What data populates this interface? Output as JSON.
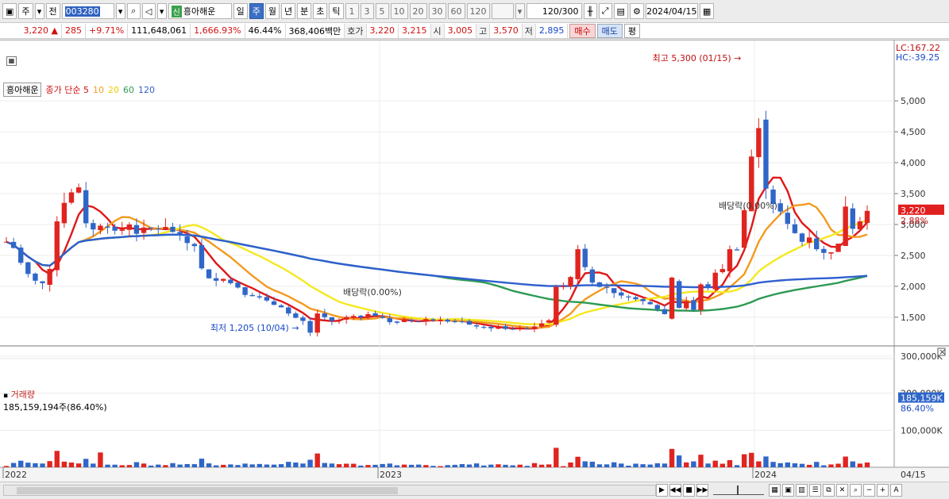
{
  "toolbar": {
    "market": "주",
    "prev": "전",
    "code": "003280",
    "badge": "신",
    "stock_name": "흥아해운",
    "periods": [
      "일",
      "주",
      "월",
      "년",
      "분",
      "초",
      "틱"
    ],
    "active_period": "주",
    "intervals": [
      "1",
      "3",
      "5",
      "10",
      "20",
      "30",
      "60",
      "120"
    ],
    "count": "120",
    "count_total": "/300",
    "date": "2024/04/15"
  },
  "quote": {
    "price": "3,220",
    "change": "285",
    "change_pct": "+9.71%",
    "volume": "111,648,061",
    "vol_ratio": "1,666.93%",
    "turnover": "46.44%",
    "amount": "368,406백만",
    "ask_label": "호가",
    "ask1": "3,220",
    "ask2": "3,215",
    "open_label": "시",
    "open": "3,005",
    "high_label": "고",
    "high": "3,570",
    "low_label": "저",
    "low": "2,895",
    "buy_label": "매수",
    "sell_label": "매도",
    "eval_label": "평"
  },
  "legend": {
    "name": "흥아해운",
    "price_label": "종가 단순 5",
    "ma10": "10",
    "ma20": "20",
    "ma60": "60",
    "ma120": "120"
  },
  "colors": {
    "up": "#e0241f",
    "down": "#2f66c8",
    "ma5": "#e01818",
    "ma10": "#f39a1e",
    "ma20": "#f5e81f",
    "ma60": "#2d9a52",
    "ma120": "#2f5fd0"
  },
  "annotations": {
    "high": "최고 5,300 (01/15)",
    "low": "최저 1,205 (10/04)",
    "div1": "배당락(0.00%)",
    "div2": "배당락(0.00%)",
    "lc": "LC:167.22",
    "hc": "HC:-39.25",
    "cur_price": "3,220",
    "cur_pct": "2.88%",
    "y_ticks": [
      "5,000",
      "4,500",
      "4,000",
      "3,500",
      "3,000",
      "2,500",
      "2,000",
      "1,500"
    ],
    "x_labels": [
      "2022",
      "2023",
      "2024"
    ],
    "x_right": "04/15"
  },
  "volume": {
    "title": "거래량",
    "value": "185,159,194주(86.40%)",
    "y_ticks": [
      "300,000K",
      "200,000K",
      "100,000K"
    ],
    "cur": "185,159K",
    "cur_pct": "86.40%"
  },
  "chart_data": {
    "type": "candlestick",
    "series": [
      {
        "name": "종가 단순 5"
      },
      {
        "name": "10"
      },
      {
        "name": "20"
      },
      {
        "name": "60"
      },
      {
        "name": "120"
      }
    ],
    "ylim": [
      1100,
      5400
    ],
    "x": [
      "2022",
      "2023",
      "2024",
      "04/15"
    ],
    "close": [
      2720,
      2620,
      2380,
      2200,
      2090,
      2050,
      2280,
      3050,
      3350,
      3520,
      3600,
      3020,
      2920,
      2980,
      2950,
      2900,
      2920,
      3000,
      2850,
      2950,
      2940,
      2920,
      2960,
      2880,
      2820,
      2700,
      2650,
      2290,
      2130,
      2090,
      2120,
      2050,
      1980,
      1860,
      1840,
      1820,
      1770,
      1700,
      1660,
      1560,
      1490,
      1440,
      1250,
      1560,
      1500,
      1440,
      1460,
      1500,
      1520,
      1500,
      1550,
      1520,
      1490,
      1420,
      1410,
      1460,
      1440,
      1430,
      1470,
      1450,
      1460,
      1430,
      1420,
      1430,
      1380,
      1350,
      1330,
      1320,
      1340,
      1310,
      1300,
      1320,
      1310,
      1350,
      1400,
      1450,
      1990,
      2000,
      2150,
      2600,
      2310,
      2060,
      1990,
      1980,
      1890,
      1850,
      1820,
      1790,
      1760,
      1710,
      1630,
      1550,
      2140,
      1650,
      1760,
      1620,
      2030,
      1980,
      2220,
      2280,
      2600,
      2580,
      3230,
      4100,
      4560,
      3580,
      3330,
      3210,
      3010,
      2860,
      2720,
      2790,
      2600,
      2540,
      2550,
      2690,
      3290,
      2930,
      3050,
      3220
    ]
  }
}
